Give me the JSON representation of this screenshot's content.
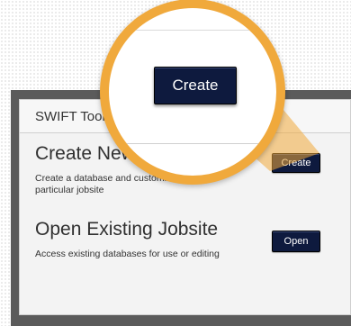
{
  "panel": {
    "title": "SWIFT Tools"
  },
  "create_section": {
    "title": "Create New Jo",
    "description_line1": "Create a database and customize it for a",
    "description_line2": "particular jobsite",
    "button_label": "Create"
  },
  "open_section": {
    "title": "Open Existing Jobsite",
    "description": "Access existing databases for use or editing",
    "button_label": "Open"
  },
  "magnifier": {
    "button_label": "Create"
  },
  "colors": {
    "accent": "#f0a93c",
    "button_bg": "#0e1a3e",
    "frame": "#5b5b5b"
  }
}
